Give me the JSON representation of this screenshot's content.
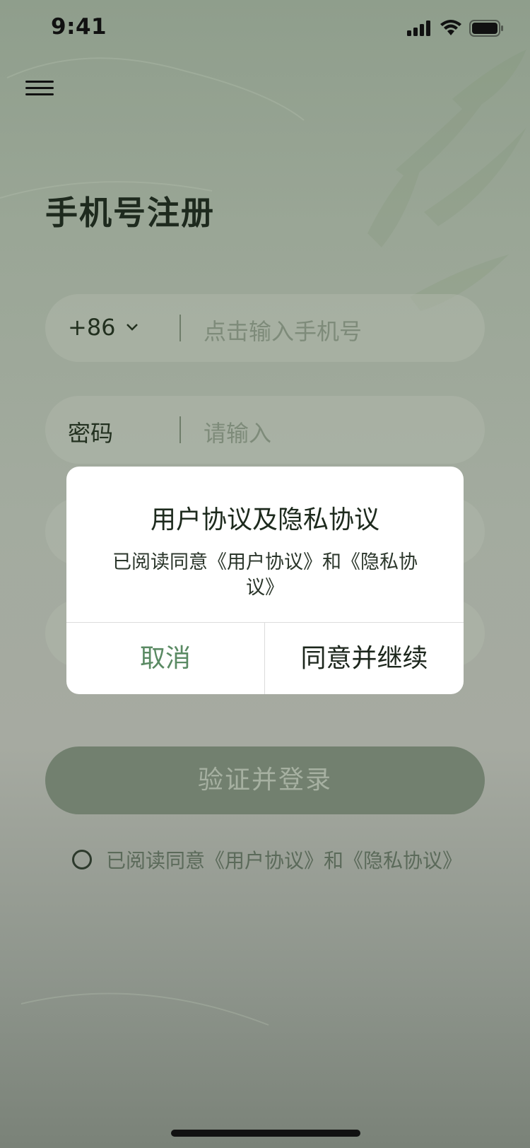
{
  "status_bar": {
    "time": "9:41"
  },
  "page": {
    "title": "手机号注册"
  },
  "phone_field": {
    "country_code": "+86",
    "placeholder": "点击输入手机号"
  },
  "password_field": {
    "label": "密码",
    "placeholder": "请输入"
  },
  "dialog": {
    "title": "用户协议及隐私协议",
    "body": "已阅读同意《用户协议》和《隐私协议》",
    "cancel_label": "取消",
    "confirm_label": "同意并继续"
  },
  "primary_button": {
    "label": "验证并登录"
  },
  "agreement": {
    "text": "已阅读同意《用户协议》和《隐私协议》",
    "checked": false
  },
  "colors": {
    "accent": "#5a8a63",
    "button_bg": "#72806f"
  }
}
